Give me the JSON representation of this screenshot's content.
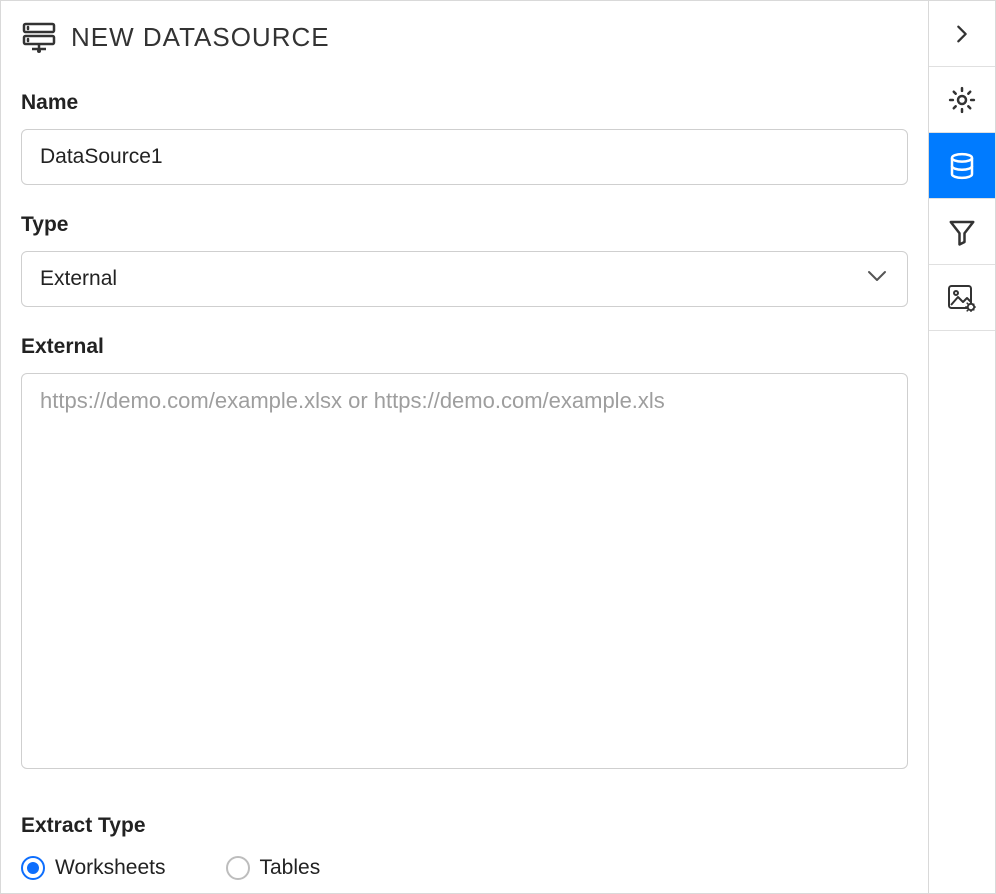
{
  "header": {
    "title": "NEW DATASOURCE"
  },
  "form": {
    "name_label": "Name",
    "name_value": "DataSource1",
    "type_label": "Type",
    "type_value": "External",
    "external_label": "External",
    "external_placeholder": "https://demo.com/example.xlsx or https://demo.com/example.xls",
    "external_value": "",
    "extract_type_label": "Extract Type",
    "radios": {
      "worksheets": "Worksheets",
      "tables": "Tables"
    },
    "selected_radio": "worksheets"
  }
}
